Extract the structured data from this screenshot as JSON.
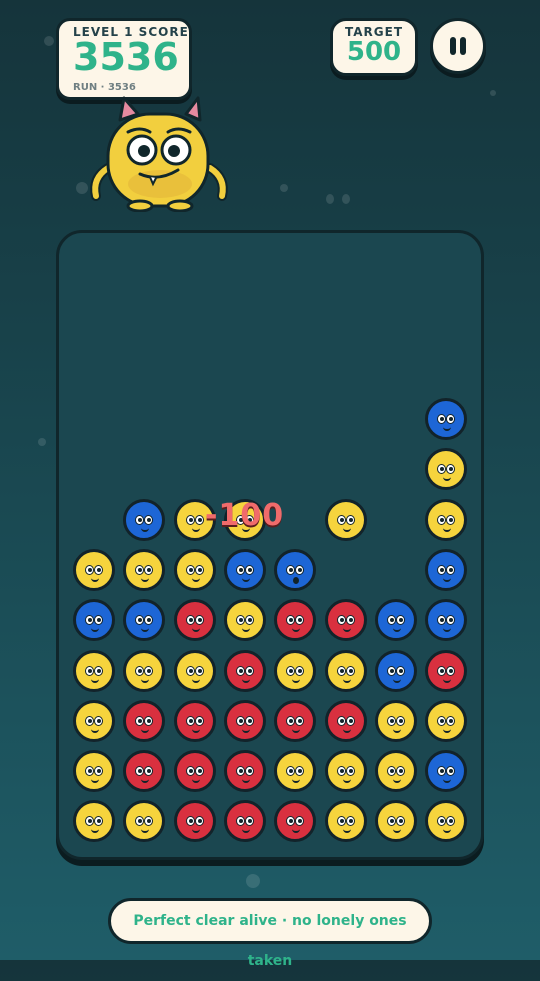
{
  "header": {
    "score_label": "LEVEL 1 SCORE",
    "score_value": "3536",
    "run_label": "RUN · 3536",
    "target_label": "TARGET",
    "target_value": "500"
  },
  "float_score": "-100",
  "status_message": "Perfect clear alive · no lonely ones taken",
  "colors": {
    "yellow": "#f6d43d",
    "red": "#d9303f",
    "blue": "#1d66d6",
    "accent": "#2fb38a"
  },
  "grid": {
    "columns": 8,
    "rows": [
      ".......b",
      ".......y",
      ".byy.y.y",
      "yyybx..b",
      "bbryrrbb",
      "yyyryybr",
      "yrrrrryy",
      "yrrryyyb",
      "yyrrryyy"
    ]
  }
}
